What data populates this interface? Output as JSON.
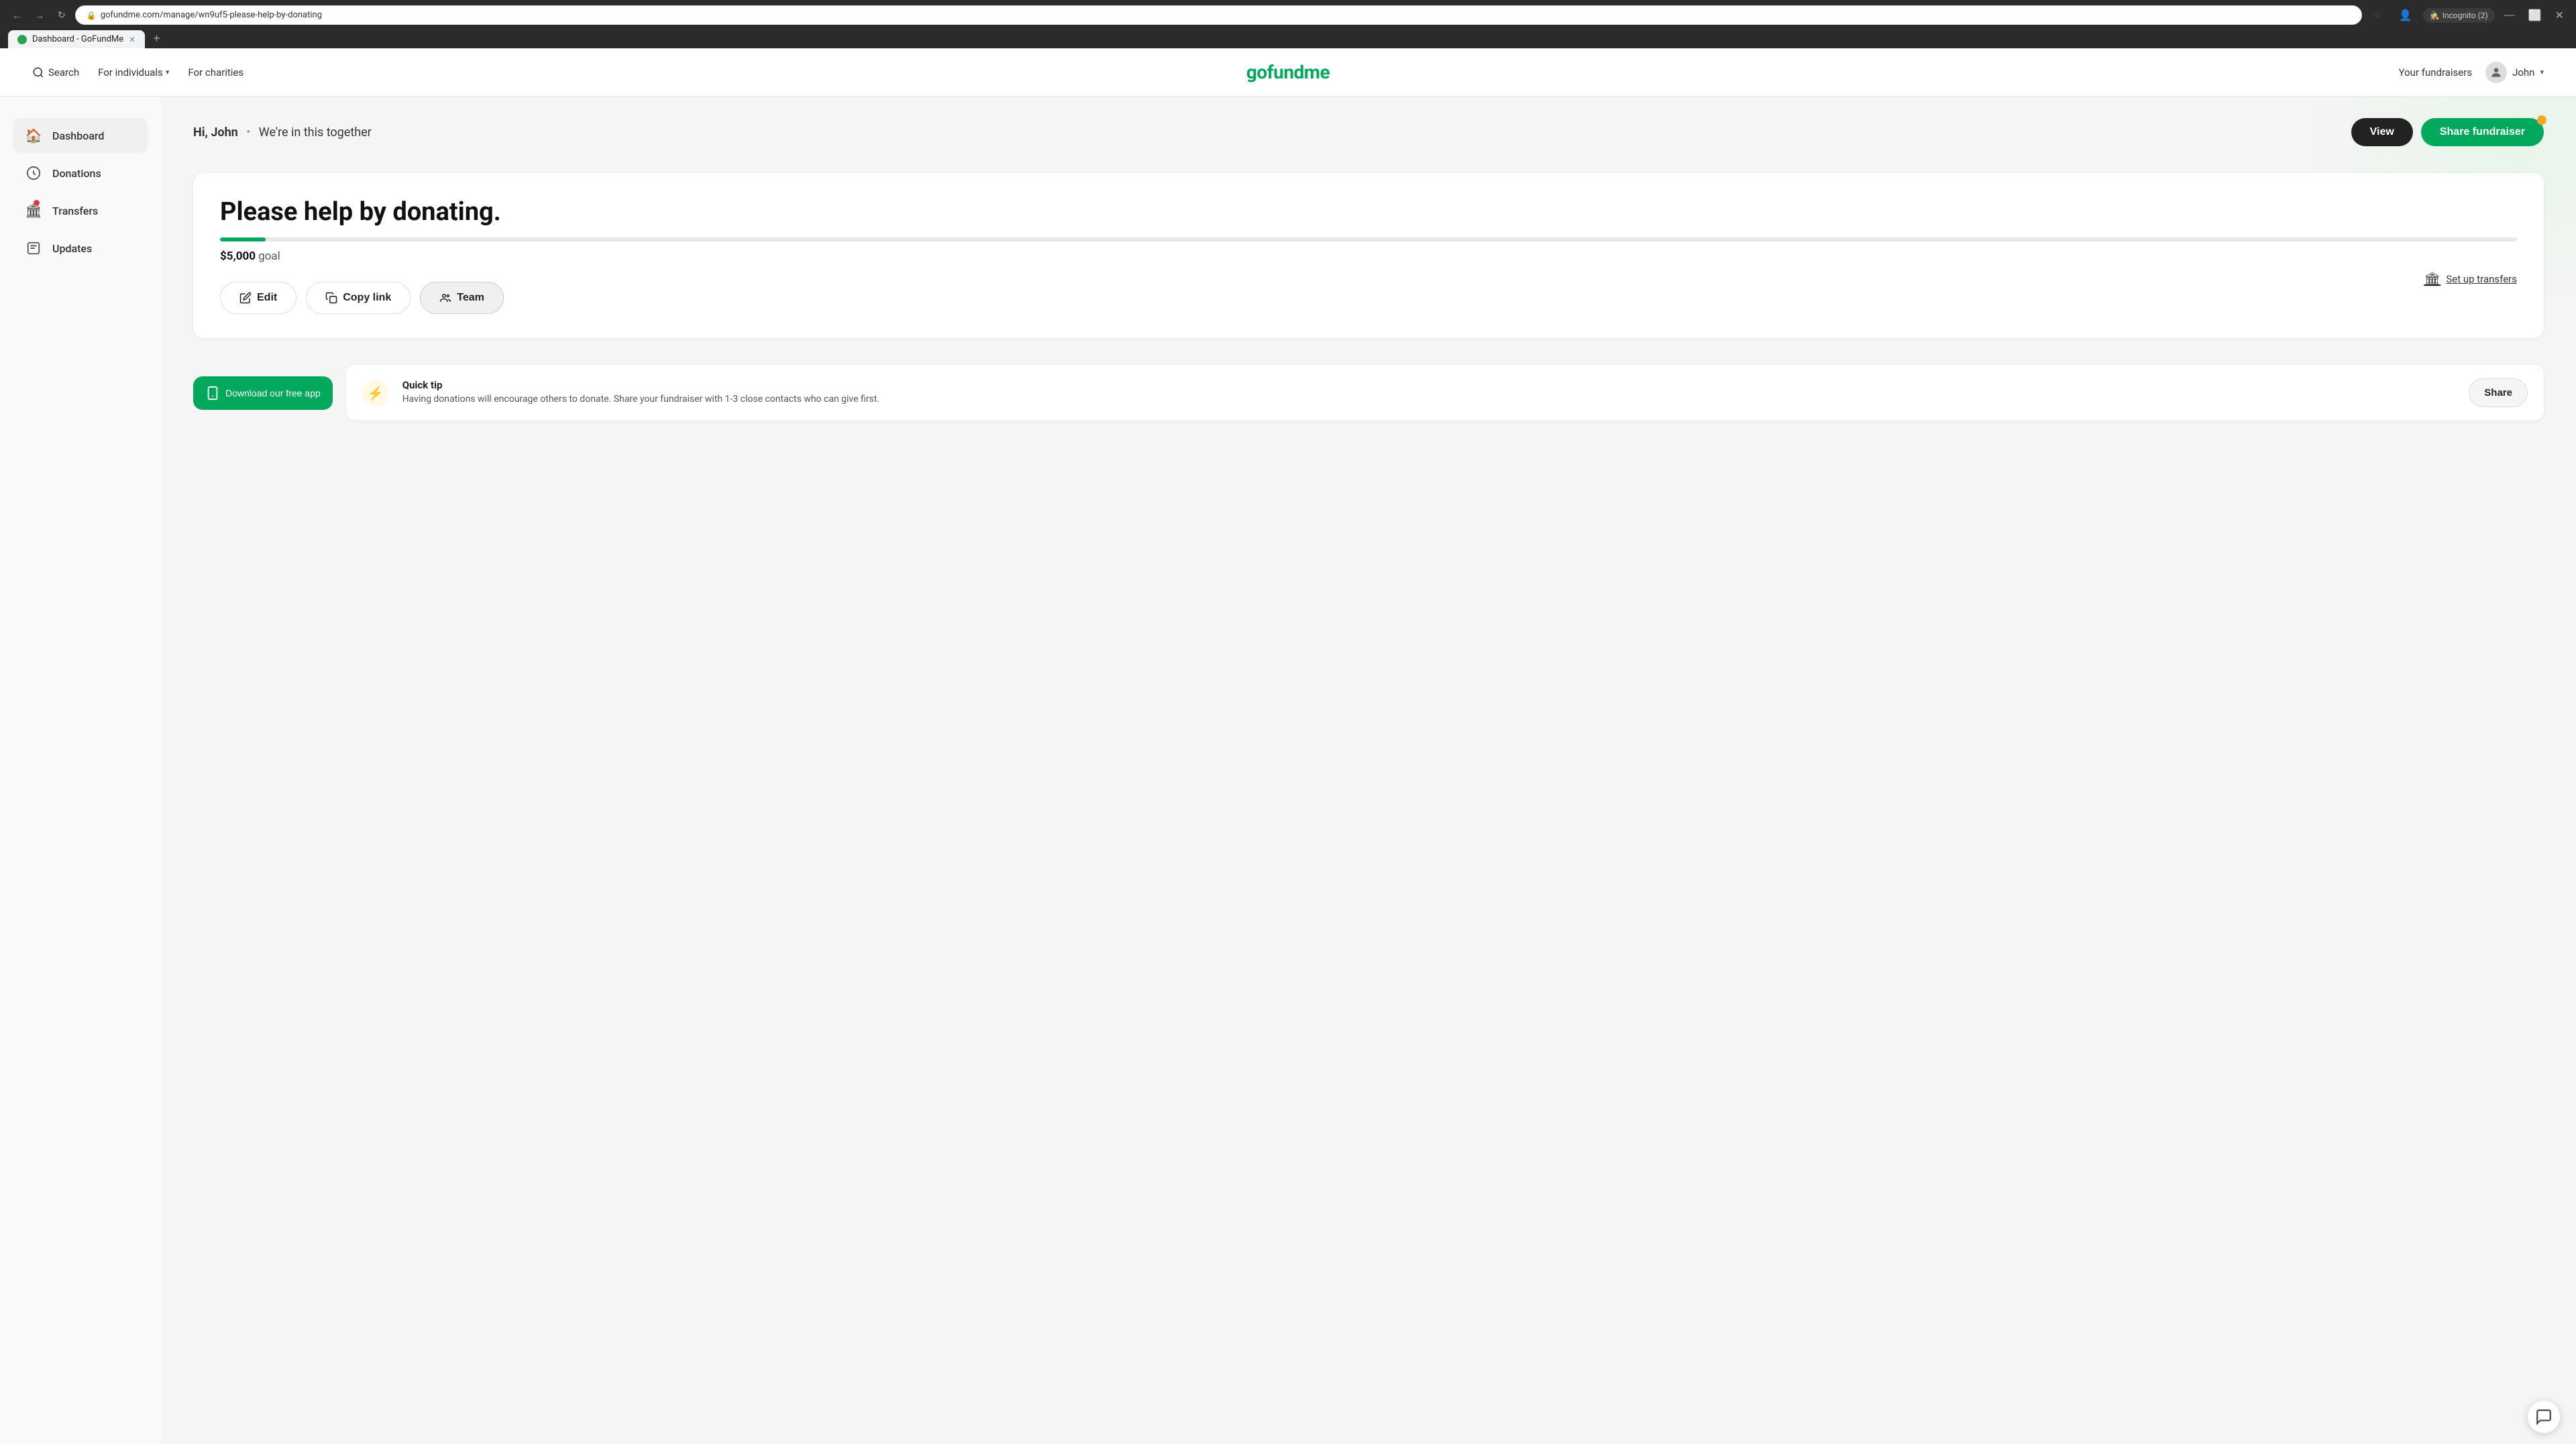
{
  "browser": {
    "tab_favicon": "🟢",
    "tab_title": "Dashboard - GoFundMe",
    "tab_close": "×",
    "new_tab_btn": "+",
    "back_btn": "←",
    "forward_btn": "→",
    "refresh_btn": "↻",
    "url": "gofundme.com/manage/wn9uf5-please-help-by-donating",
    "bookmark_icon": "☆",
    "incognito_label": "Incognito (2)",
    "profile_icon": "👤"
  },
  "nav": {
    "search_label": "Search",
    "for_individuals_label": "For individuals",
    "for_charities_label": "For charities",
    "logo_text": "gofundme",
    "your_fundraisers_label": "Your fundraisers",
    "user_name": "John"
  },
  "sidebar": {
    "items": [
      {
        "id": "dashboard",
        "label": "Dashboard",
        "icon": "🏠",
        "active": true,
        "has_dot": false
      },
      {
        "id": "donations",
        "label": "Donations",
        "icon": "🎯",
        "active": false,
        "has_dot": false
      },
      {
        "id": "transfers",
        "label": "Transfers",
        "icon": "🏛",
        "active": false,
        "has_dot": true
      },
      {
        "id": "updates",
        "label": "Updates",
        "icon": "💬",
        "active": false,
        "has_dot": false
      }
    ]
  },
  "dashboard": {
    "greeting": "Hi, John",
    "greeting_sub": "We're in this together",
    "view_btn": "View",
    "share_btn": "Share fundraiser",
    "fundraiser_title": "Please help by donating.",
    "goal_amount": "$5,000",
    "goal_label": "goal",
    "progress_percent": 2,
    "set_up_transfers": "Set up transfers",
    "actions": {
      "edit_label": "Edit",
      "copy_link_label": "Copy link",
      "team_label": "Team"
    }
  },
  "bottom": {
    "download_app_label": "Download our free app",
    "quick_tip_label": "Quick tip",
    "quick_tip_text": "Having donations will encourage others to donate. Share your fundraiser with 1-3 close contacts who can give first.",
    "share_label": "Share"
  }
}
